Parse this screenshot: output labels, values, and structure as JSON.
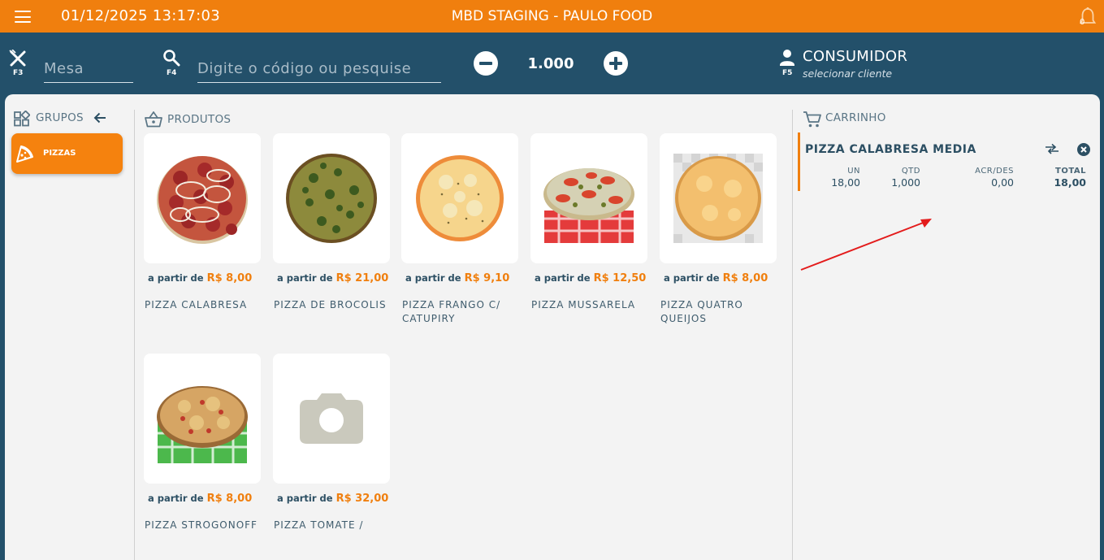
{
  "topbar": {
    "datetime": "01/12/2025 13:17:03",
    "title": "MBD STAGING - PAULO FOOD",
    "notification_count": "0"
  },
  "toolbar": {
    "table_key": "F3",
    "table_placeholder": "Mesa",
    "search_key": "F4",
    "search_placeholder": "Digite o código ou pesquise",
    "quantity": "1.000",
    "client_key": "F5",
    "client_name": "CONSUMIDOR",
    "client_hint": "selecionar cliente"
  },
  "groups": {
    "heading": "GRUPOS",
    "items": [
      {
        "label": "PIZZAS",
        "icon": "pizza-slice-icon"
      }
    ]
  },
  "products": {
    "heading": "PRODUTOS",
    "price_prefix": "a partir de",
    "items": [
      {
        "name": "PIZZA CALABRESA",
        "price": "R$ 8,00",
        "image": "pizza-calabresa"
      },
      {
        "name": "PIZZA DE BROCOLIS",
        "price": "R$ 21,00",
        "image": "pizza-brocolis"
      },
      {
        "name": "PIZZA FRANGO C/ CATUPIRY",
        "price": "R$ 9,10",
        "image": "pizza-frango"
      },
      {
        "name": "PIZZA MUSSARELA",
        "price": "R$ 12,50",
        "image": "pizza-mussarela"
      },
      {
        "name": "PIZZA QUATRO QUEIJOS",
        "price": "R$ 8,00",
        "image": "pizza-quatro-queijos"
      },
      {
        "name": "PIZZA STROGONOFF",
        "price": "R$ 8,00",
        "image": "pizza-strogonoff"
      },
      {
        "name": "PIZZA TOMATE /",
        "price": "R$ 32,00",
        "image": "camera-placeholder-icon"
      }
    ]
  },
  "cart": {
    "heading": "CARRINHO",
    "items": [
      {
        "name": "PIZZA CALABRESA MEDIA",
        "un_label": "UN",
        "un": "18,00",
        "qtd_label": "QTD",
        "qtd": "1,000",
        "acr_label": "ACR/DES",
        "acr": "0,00",
        "total_label": "TOTAL",
        "total": "18,00"
      }
    ]
  },
  "colors": {
    "accent": "#f07f0e",
    "navy": "#23506a",
    "annotation": "#e31b1b"
  }
}
